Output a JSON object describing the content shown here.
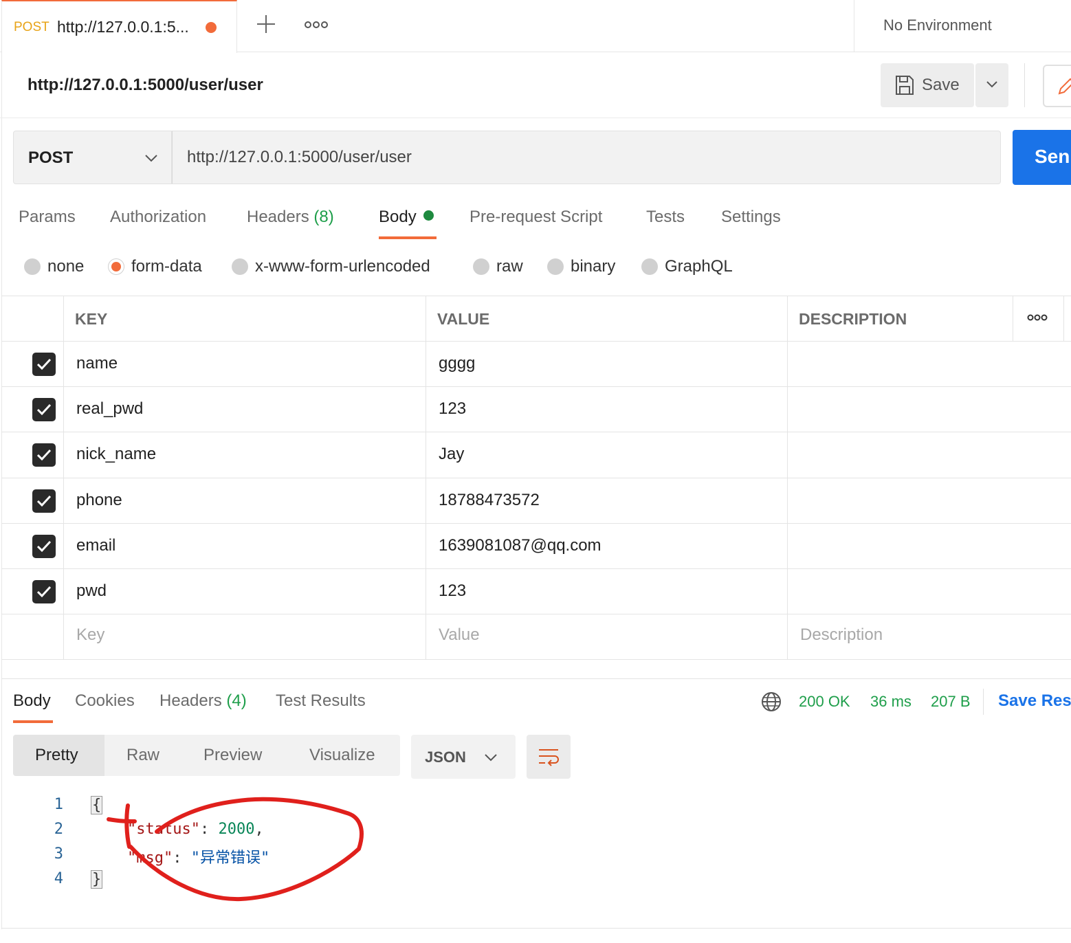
{
  "tab": {
    "method": "POST",
    "title": "http://127.0.0.1:5...",
    "environment": "No Environment"
  },
  "request": {
    "name": "http://127.0.0.1:5000/user/user",
    "save_label": "Save",
    "method": "POST",
    "url": "http://127.0.0.1:5000/user/user",
    "send_label": "Sen"
  },
  "request_tabs": {
    "params": "Params",
    "authorization": "Authorization",
    "headers": "Headers",
    "headers_count": "(8)",
    "body": "Body",
    "prerequest": "Pre-request Script",
    "tests": "Tests",
    "settings": "Settings"
  },
  "body_types": [
    "none",
    "form-data",
    "x-www-form-urlencoded",
    "raw",
    "binary",
    "GraphQL"
  ],
  "body_type_selected": "form-data",
  "form_table": {
    "headers": {
      "key": "KEY",
      "value": "VALUE",
      "description": "DESCRIPTION"
    },
    "rows": [
      {
        "key": "name",
        "value": "gggg"
      },
      {
        "key": "real_pwd",
        "value": "123"
      },
      {
        "key": "nick_name",
        "value": "Jay"
      },
      {
        "key": "phone",
        "value": "18788473572"
      },
      {
        "key": "email",
        "value": "1639081087@qq.com"
      },
      {
        "key": "pwd",
        "value": "123"
      }
    ],
    "placeholders": {
      "key": "Key",
      "value": "Value",
      "description": "Description"
    }
  },
  "response": {
    "tabs": {
      "body": "Body",
      "cookies": "Cookies",
      "headers": "Headers",
      "headers_count": "(4)",
      "test_results": "Test Results"
    },
    "status": "200 OK",
    "time": "36 ms",
    "size": "207 B",
    "save_label": "Save Res",
    "views": [
      "Pretty",
      "Raw",
      "Preview",
      "Visualize"
    ],
    "format": "JSON",
    "code": {
      "line_numbers": [
        "1",
        "2",
        "3",
        "4"
      ],
      "open_brace": "{",
      "close_brace": "}",
      "status_key": "\"status\"",
      "status_value": "2000",
      "msg_key": "\"msg\"",
      "msg_value": "\"异常错误\""
    }
  },
  "colors": {
    "accent": "#f26b3a",
    "send": "#1a73e8",
    "status_ok": "#1e9e4a",
    "annotation": "#e0201c"
  }
}
